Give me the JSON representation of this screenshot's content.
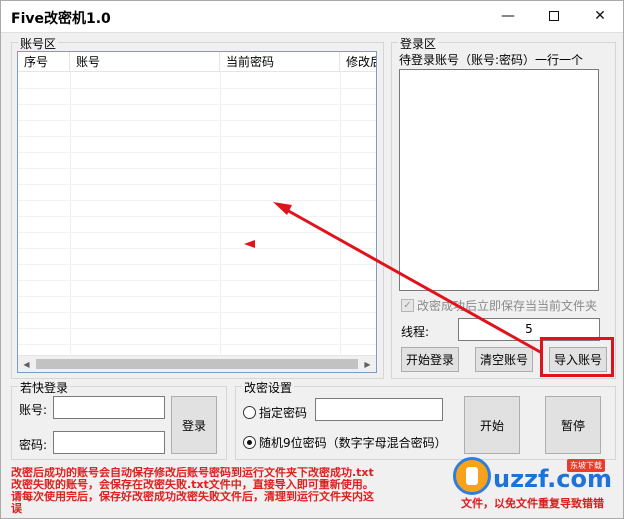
{
  "window": {
    "title": "Five改密机1.0",
    "minimize_glyph": "—",
    "close_glyph": "✕"
  },
  "accounts_panel": {
    "title": "账号区",
    "columns": [
      "序号",
      "账号",
      "当前密码",
      "修改后"
    ]
  },
  "login_panel": {
    "title": "登录区",
    "hint": "待登录账号（账号:密码）一行一个",
    "textarea_value": "",
    "auto_save_label": "改密成功后立即保存当当前文件夹",
    "auto_save_checked": true,
    "threads_label": "线程:",
    "threads_value": "5",
    "start_login_button": "开始登录",
    "clear_accounts_button": "清空账号",
    "import_accounts_button": "导入账号"
  },
  "quick_login": {
    "title": "若快登录",
    "account_label": "账号:",
    "password_label": "密码:",
    "account_value": "",
    "password_value": "",
    "login_button": "登录"
  },
  "password_settings": {
    "title": "改密设置",
    "specified_label": "指定密码",
    "specified_selected": false,
    "specified_value": "",
    "random_label": "随机9位密码（数字字母混合密码）",
    "random_selected": true,
    "start_button": "开始",
    "pause_button": "暂停"
  },
  "notes": {
    "lines": [
      "改密后成功的账号会自动保存修改后账号密码到运行文件夹下改密成功.txt",
      "改密失败的账号，会保存在改密失败.txt文件中，直接导入即可重新使用。",
      "请每次使用完后，保存好改密成功改密失败文件后，清理到运行文件夹内这",
      "误"
    ],
    "right_fragment": "文件，以免文件重复导致错错"
  },
  "watermark": {
    "text": "uzzf.com",
    "badge": "东坡下载"
  },
  "colors": {
    "accent_red": "#e0131d",
    "grid_border": "#7a9cc6",
    "notes_red": "#e01f1f",
    "logo_blue": "#1e73d9"
  }
}
